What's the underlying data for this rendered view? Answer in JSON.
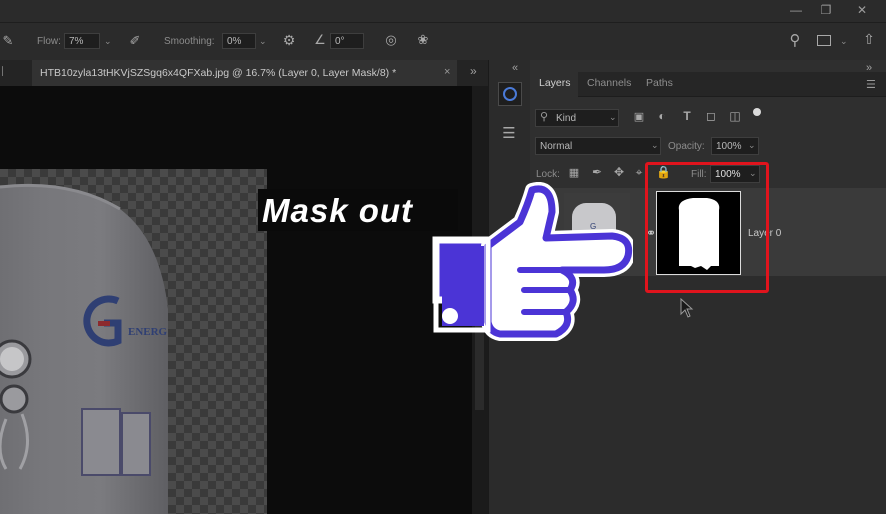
{
  "options_bar": {
    "flow_label": "Flow:",
    "flow_value": "7%",
    "smoothing_label": "Smoothing:",
    "smoothing_value": "0%",
    "angle_value": "0°"
  },
  "document": {
    "tab_title": "HTB10zyla13tHKVjSZSgq6x4QFXab.jpg @ 16.7% (Layer 0, Layer Mask/8) *",
    "close_glyph": "×"
  },
  "callout": {
    "text": "Mask out"
  },
  "layers_panel": {
    "tabs": [
      "Layers",
      "Channels",
      "Paths"
    ],
    "filter_kind": "Kind",
    "blend_mode": "Normal",
    "opacity_label": "Opacity:",
    "opacity_value": "100%",
    "lock_label": "Lock:",
    "fill_label": "Fill:",
    "fill_value": "100%",
    "layer_name": "Layer 0"
  },
  "accent_colors": {
    "highlight_box": "#e0141d",
    "pointer_hand": "#4b34d6"
  },
  "icons": [
    "brush-icon",
    "airbrush-icon",
    "gear-icon",
    "angle-icon",
    "pressure-icon",
    "symmetry-icon",
    "search-icon",
    "workspace-icon",
    "share-icon",
    "color-wheel-icon",
    "adjustments-icon",
    "lock-icon",
    "chain-link-icon",
    "cursor-icon",
    "pointing-hand-icon"
  ]
}
